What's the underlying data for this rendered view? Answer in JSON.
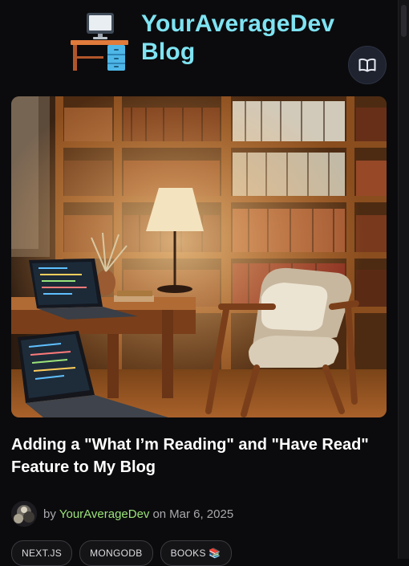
{
  "header": {
    "brand_line1": "YourAverageDev",
    "brand_line2": "Blog",
    "logo_icon": "desk-computer-icon",
    "reading_button_icon": "open-book-icon"
  },
  "post": {
    "image_icon": "library-reading-nook-image",
    "title": "Adding a \"What I’m Reading\" and \"Have Read\" Feature to My Blog",
    "byline_prefix": "by",
    "author": "YourAverageDev",
    "date_prefix": "on",
    "date": "Mar 6, 2025",
    "tags": [
      "NEXT.JS",
      "MONGODB",
      "BOOKS 📚"
    ]
  },
  "colors": {
    "brand": "#7fe3f2",
    "author": "#9be37a",
    "background": "#0b0b0d"
  }
}
